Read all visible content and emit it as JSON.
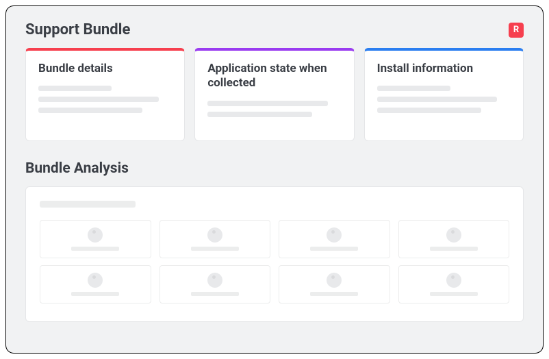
{
  "header": {
    "title": "Support Bundle",
    "brand_letter": "R"
  },
  "cards": [
    {
      "title": "Bundle details",
      "accent": "red"
    },
    {
      "title": "Application state when collected",
      "accent": "purple"
    },
    {
      "title": "Install information",
      "accent": "blue"
    }
  ],
  "analysis": {
    "title": "Bundle Analysis"
  },
  "colors": {
    "accent_red": "#f63f4e",
    "accent_purple": "#9a3cf0",
    "accent_blue": "#2b7ef0"
  }
}
